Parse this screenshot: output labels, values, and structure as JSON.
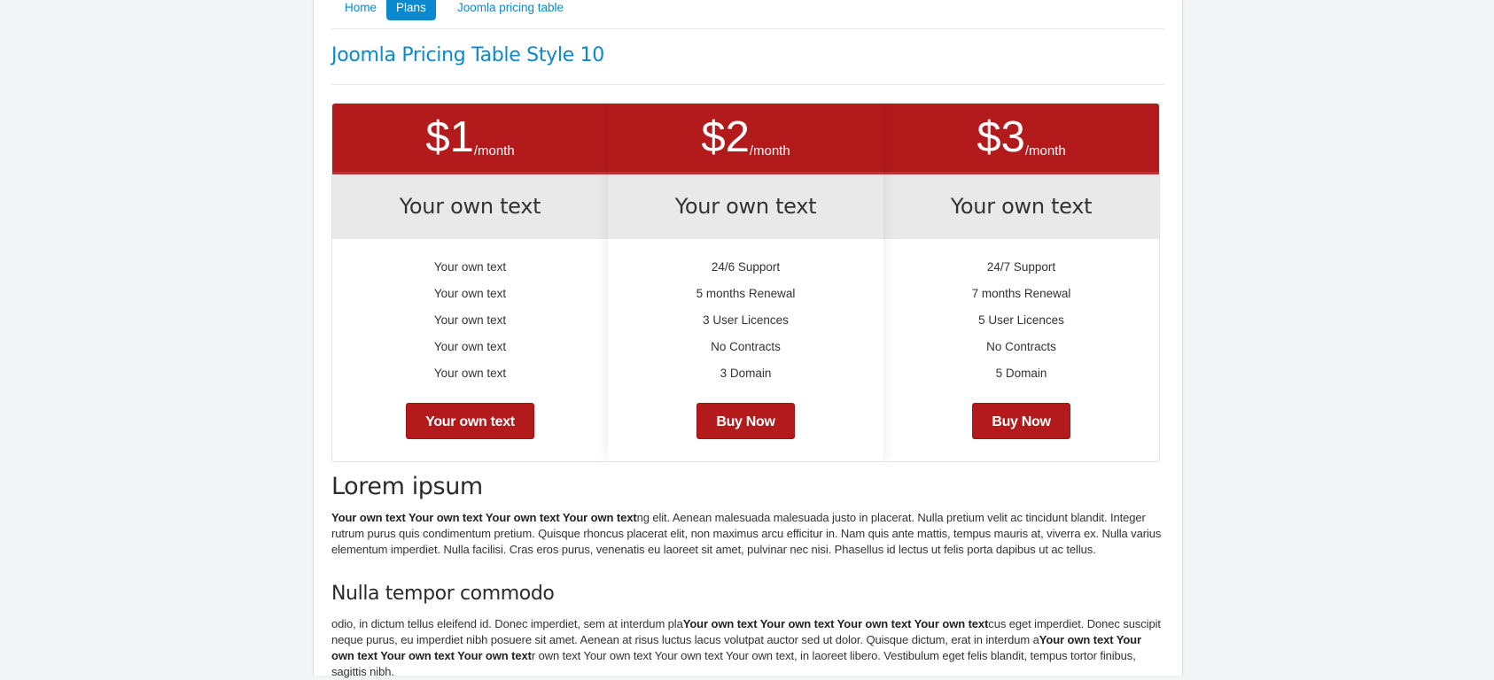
{
  "nav": {
    "items": [
      {
        "label": "Home",
        "active": false
      },
      {
        "label": "Plans",
        "active": true
      },
      {
        "label": "Joomla pricing table",
        "active": false
      }
    ]
  },
  "page": {
    "title": "Joomla Pricing Table Style 10"
  },
  "colors": {
    "accent": "#0a88d0",
    "plan_red": "#b21a1c",
    "plan_name_bg": "#e9e9e9"
  },
  "pricing": {
    "plans": [
      {
        "price": "$1",
        "period": "/month",
        "name": "Your own text",
        "features": [
          "Your own text",
          "Your own text",
          "Your own text",
          "Your own text",
          "Your own text"
        ],
        "button": "Your own text"
      },
      {
        "price": "$2",
        "period": "/month",
        "name": "Your own text",
        "features": [
          "24/6 Support",
          "5 months Renewal",
          "3 User Licences",
          "No Contracts",
          "3 Domain"
        ],
        "button": "Buy Now"
      },
      {
        "price": "$3",
        "period": "/month",
        "name": "Your own text",
        "features": [
          "24/7 Support",
          "7 months Renewal",
          "5 User Licences",
          "No Contracts",
          "5 Domain"
        ],
        "button": "Buy Now"
      }
    ]
  },
  "article": {
    "section1": {
      "heading": "Lorem ipsum",
      "bold_lead": "Your own text Your own text Your own text Your own text",
      "text": "ng elit. Aenean malesuada malesuada justo in placerat. Nulla pretium velit ac tincidunt blandit. Integer rutrum purus quis condimentum pretium. Quisque rhoncus placerat elit, non maximus arcu efficitur in. Nam quis ante mattis, tempus mauris at, viverra ex. Nulla varius elementum imperdiet. Nulla facilisi. Cras eros purus, venenatis eu laoreet sit amet, pulvinar nec nisi. Phasellus id lectus ut felis porta dapibus ut ac tellus."
    },
    "section2": {
      "heading": "Nulla tempor commodo",
      "text_a": "odio, in dictum tellus eleifend id. Donec imperdiet, sem at interdum pla",
      "bold_a": "Your own text Your own text Your own text Your own text",
      "text_b": "cus eget imperdiet. Donec suscipit neque purus, eu imperdiet nibh posuere sit amet. Aenean at risus luctus lacus volutpat auctor sed ut dolor. Quisque dictum, erat in interdum a",
      "bold_b": "Your own text Your own text Your own text Your own text",
      "text_c": "r own text Your own text Your own text Your own text, in laoreet libero. Vestibulum eget felis blandit, tempus tortor finibus, sagittis nibh."
    }
  }
}
